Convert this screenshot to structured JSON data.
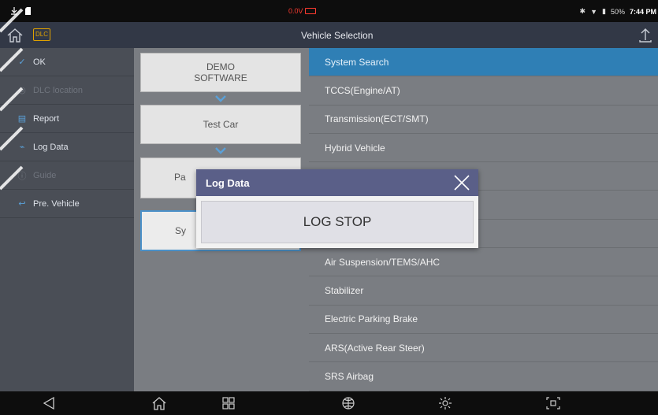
{
  "status_bar": {
    "voltage": "0.0V",
    "battery_percent": "50%",
    "time": "7:44 PM"
  },
  "titlebar": {
    "title": "Vehicle Selection",
    "dlc_label": "DLC"
  },
  "sidebar": {
    "items": [
      {
        "label": "OK",
        "icon": "check-icon",
        "enabled": true
      },
      {
        "label": "DLC location",
        "icon": "location-icon",
        "enabled": false
      },
      {
        "label": "Report",
        "icon": "report-icon",
        "enabled": true
      },
      {
        "label": "Log Data",
        "icon": "chart-icon",
        "enabled": true
      },
      {
        "label": "Guide",
        "icon": "info-icon",
        "enabled": false
      },
      {
        "label": "Pre. Vehicle",
        "icon": "back-arrow-icon",
        "enabled": true
      }
    ]
  },
  "breadcrumb": {
    "items": [
      {
        "label_line1": "DEMO",
        "label_line2": "SOFTWARE"
      },
      {
        "label": "Test Car"
      },
      {
        "label": "Pa"
      },
      {
        "label": "Sy"
      }
    ]
  },
  "system_list": {
    "items": [
      "System Search",
      "TCCS(Engine/AT)",
      "Transmission(ECT/SMT)",
      "Hybrid Vehicle",
      "",
      "",
      "",
      "Air Suspension/TEMS/AHC",
      "Stabilizer",
      "Electric Parking Brake",
      "ARS(Active Rear Steer)",
      "SRS Airbag"
    ],
    "selected_index": 0
  },
  "dialog": {
    "title": "Log Data",
    "button_label": "LOG STOP"
  },
  "colors": {
    "accent": "#2f7fb5",
    "dialog_header": "#5a5f88",
    "voltage_warning": "#ff3b30"
  }
}
